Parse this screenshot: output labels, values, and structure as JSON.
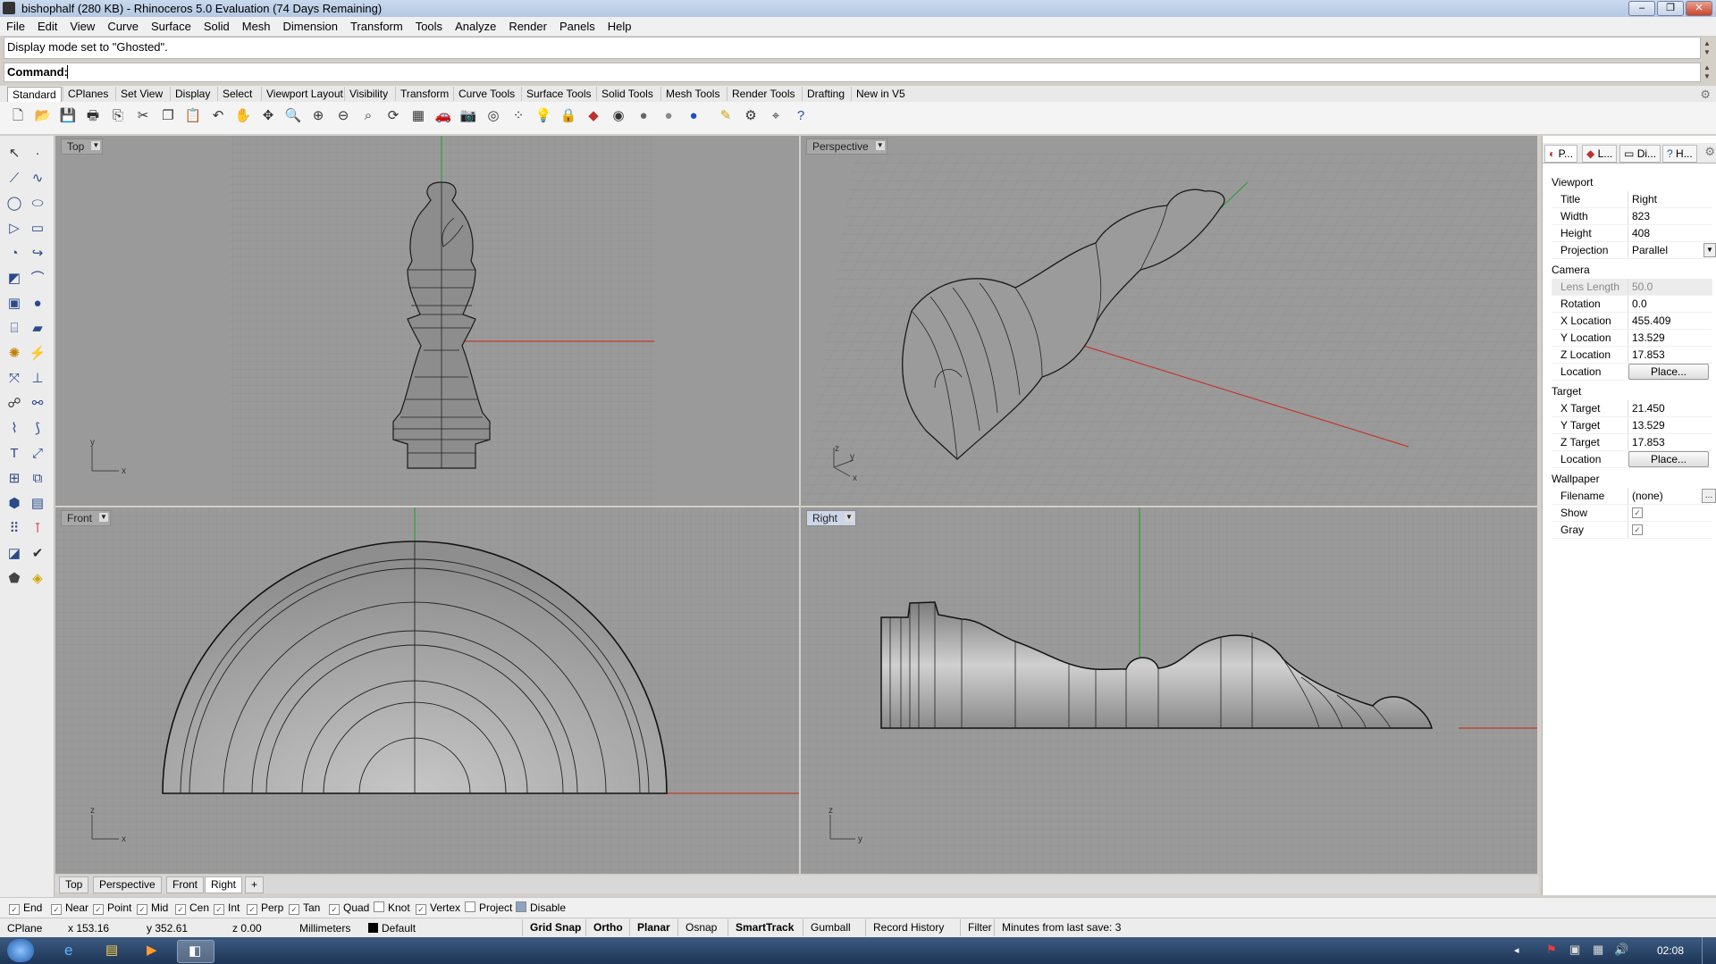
{
  "window": {
    "title": "bishophalf (280 KB) - Rhinoceros 5.0 Evaluation (74 Days Remaining)",
    "controls": {
      "minimize": "–",
      "maximize": "❐",
      "close": "✕"
    }
  },
  "menu": [
    "File",
    "Edit",
    "View",
    "Curve",
    "Surface",
    "Solid",
    "Mesh",
    "Dimension",
    "Transform",
    "Tools",
    "Analyze",
    "Render",
    "Panels",
    "Help"
  ],
  "command_history": "Display mode set to \"Ghosted\".",
  "command_prompt": "Command:",
  "toolbar_tabs": [
    "Standard",
    "CPlanes",
    "Set View",
    "Display",
    "Select",
    "Viewport Layout",
    "Visibility",
    "Transform",
    "Curve Tools",
    "Surface Tools",
    "Solid Tools",
    "Mesh Tools",
    "Render Tools",
    "Drafting",
    "New in V5"
  ],
  "toolbar_icons": [
    "new-icon",
    "open-icon",
    "save-icon",
    "print-icon",
    "import-icon",
    "cut-icon",
    "copy-icon",
    "paste-icon",
    "undo-icon",
    "pan-icon",
    "move-view-icon",
    "zoom-icon",
    "zoom-window-icon",
    "zoom-extents-icon",
    "zoom-selected-icon",
    "rotate-view-icon",
    "four-views-icon",
    "car-icon",
    "camera-icon",
    "target-icon",
    "points-icon",
    "light-icon",
    "lock-icon",
    "layer-icon",
    "color-wheel-icon",
    "shade-icon",
    "rendered-sphere-icon",
    "blue-sphere-icon",
    "properties-icon",
    "options-icon",
    "osnap-icon",
    "help-icon"
  ],
  "viewports": {
    "top": {
      "label": "Top",
      "axis_a": "y",
      "axis_b": "x"
    },
    "perspective": {
      "label": "Perspective",
      "axis_a": "z",
      "axis_b": "y",
      "axis_c": "x"
    },
    "front": {
      "label": "Front",
      "axis_a": "z",
      "axis_b": "x"
    },
    "right": {
      "label": "Right",
      "axis_a": "z",
      "axis_b": "y"
    }
  },
  "viewport_tabs": [
    "Top",
    "Perspective",
    "Front",
    "Right"
  ],
  "viewport_tab_add": "+",
  "panel": {
    "tabs": [
      "P...",
      "L...",
      "Di...",
      "H..."
    ],
    "sections": {
      "viewport": "Viewport",
      "camera": "Camera",
      "target": "Target",
      "wallpaper": "Wallpaper"
    },
    "viewport_rows": [
      {
        "key": "Title",
        "value": "Right"
      },
      {
        "key": "Width",
        "value": "823"
      },
      {
        "key": "Height",
        "value": "408"
      },
      {
        "key": "Projection",
        "value": "Parallel"
      }
    ],
    "camera_rows": [
      {
        "key": "Lens Length",
        "value": "50.0"
      },
      {
        "key": "Rotation",
        "value": "0.0"
      },
      {
        "key": "X Location",
        "value": "455.409"
      },
      {
        "key": "Y Location",
        "value": "13.529"
      },
      {
        "key": "Z Location",
        "value": "17.853"
      },
      {
        "key": "Location",
        "button": "Place..."
      }
    ],
    "target_rows": [
      {
        "key": "X Target",
        "value": "21.450"
      },
      {
        "key": "Y Target",
        "value": "13.529"
      },
      {
        "key": "Z Target",
        "value": "17.853"
      },
      {
        "key": "Location",
        "button": "Place..."
      }
    ],
    "wallpaper_rows": [
      {
        "key": "Filename",
        "value": "(none)"
      },
      {
        "key": "Show",
        "checked": true
      },
      {
        "key": "Gray",
        "checked": true
      }
    ]
  },
  "osnaps": [
    {
      "label": "End",
      "checked": true
    },
    {
      "label": "Near",
      "checked": true
    },
    {
      "label": "Point",
      "checked": true
    },
    {
      "label": "Mid",
      "checked": true
    },
    {
      "label": "Cen",
      "checked": true
    },
    {
      "label": "Int",
      "checked": true
    },
    {
      "label": "Perp",
      "checked": true
    },
    {
      "label": "Tan",
      "checked": true
    },
    {
      "label": "Quad",
      "checked": true
    },
    {
      "label": "Knot",
      "checked": false
    },
    {
      "label": "Vertex",
      "checked": true
    },
    {
      "label": "Project",
      "checked": false
    },
    {
      "label": "Disable",
      "checked": false
    }
  ],
  "status": {
    "cplane": "CPlane",
    "x": "x 153.16",
    "y": "y 352.61",
    "z": "z 0.00",
    "units": "Millimeters",
    "layer": "Default",
    "buttons": [
      {
        "label": "Grid Snap",
        "bold": true
      },
      {
        "label": "Ortho",
        "bold": true
      },
      {
        "label": "Planar",
        "bold": true
      },
      {
        "label": "Osnap",
        "bold": false
      },
      {
        "label": "SmartTrack",
        "bold": true
      },
      {
        "label": "Gumball",
        "bold": false
      },
      {
        "label": "Record History",
        "bold": false
      },
      {
        "label": "Filter",
        "bold": false
      }
    ],
    "save_info": "Minutes from last save: 3"
  },
  "taskbar": {
    "clock": "02:08"
  },
  "colors": {
    "viewport_bg": "#9a9a9a",
    "x_axis": "#c0392b",
    "y_axis": "#2e9e3a",
    "active_label": "#ccd6e8"
  }
}
